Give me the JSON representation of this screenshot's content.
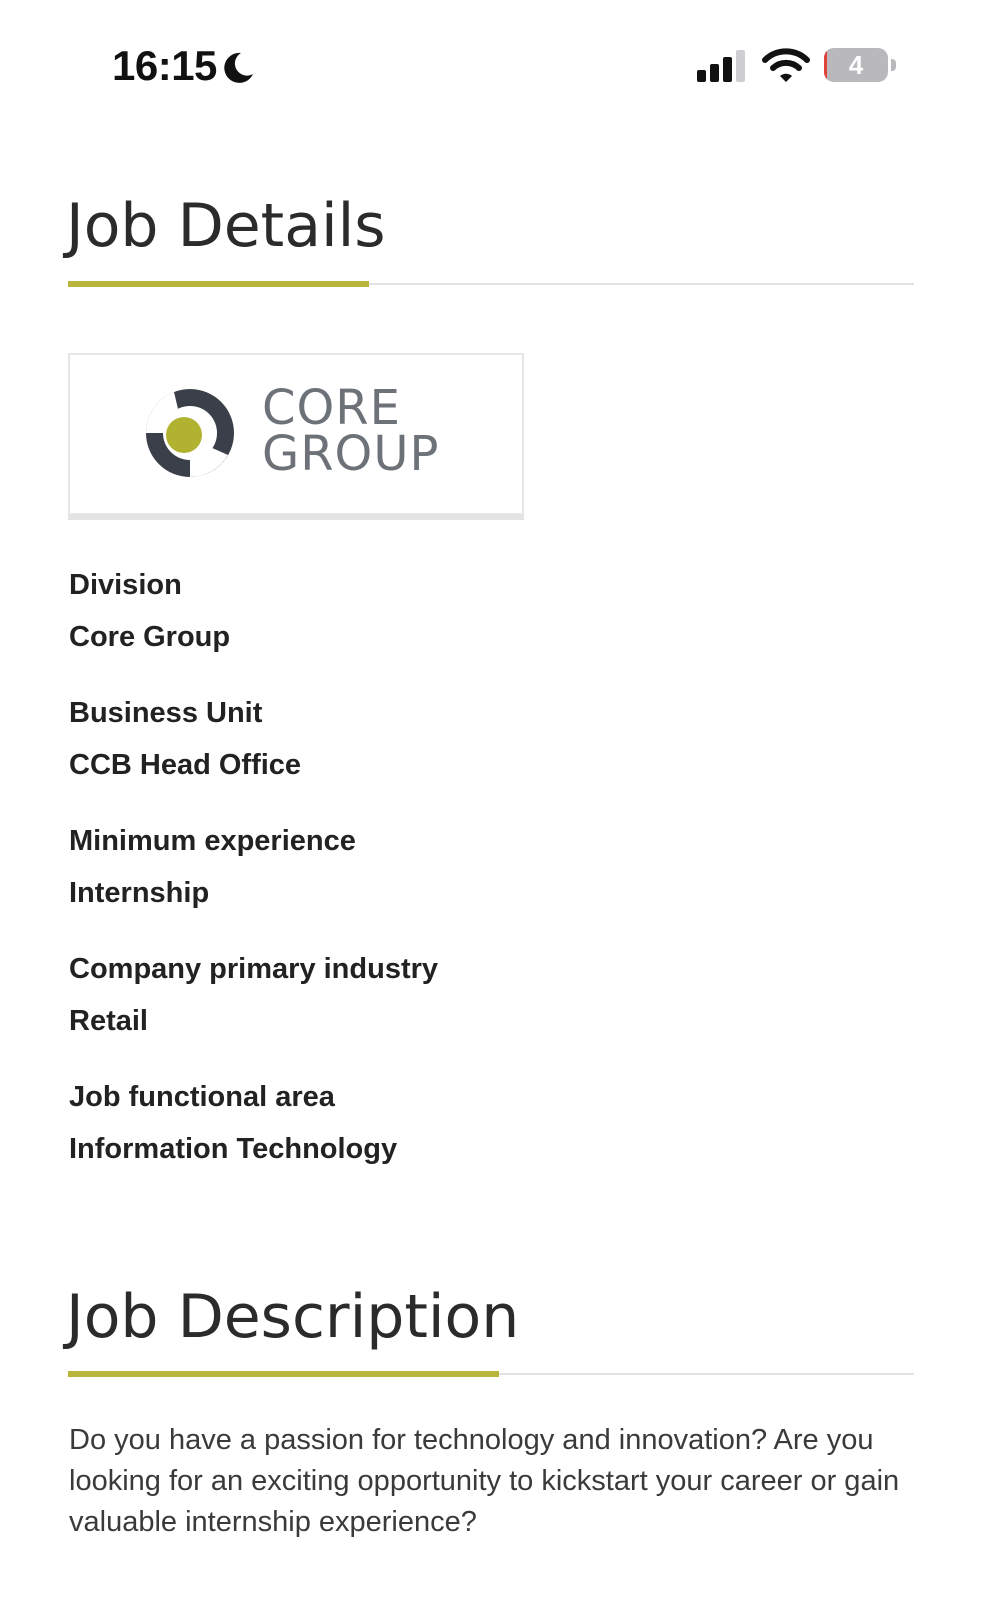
{
  "status_bar": {
    "time": "16:15",
    "battery_level": "4",
    "battery_percent": 4,
    "icons": [
      "moon-icon",
      "cellular-signal-icon",
      "wifi-icon",
      "battery-icon"
    ]
  },
  "job_details": {
    "title": "Job Details",
    "logo": {
      "line1": "CORE",
      "line2": "GROUP"
    },
    "items": [
      {
        "label": "Division",
        "value": "Core Group"
      },
      {
        "label": "Business Unit",
        "value": "CCB Head Office"
      },
      {
        "label": "Minimum experience",
        "value": "Internship"
      },
      {
        "label": "Company primary industry",
        "value": "Retail"
      },
      {
        "label": "Job functional area",
        "value": "Information Technology"
      }
    ]
  },
  "job_description": {
    "title": "Job Description",
    "text": "Do you have a passion for technology and innovation? Are you looking for an exciting opportunity to kickstart your career or gain valuable internship experience?"
  },
  "colors": {
    "accent": "#b9b53a",
    "heading": "#2b2b2b",
    "logo_text": "#6d7279",
    "logo_dark": "#3a3f4a",
    "logo_dot": "#b2b231",
    "battery_low": "#e0423a"
  }
}
